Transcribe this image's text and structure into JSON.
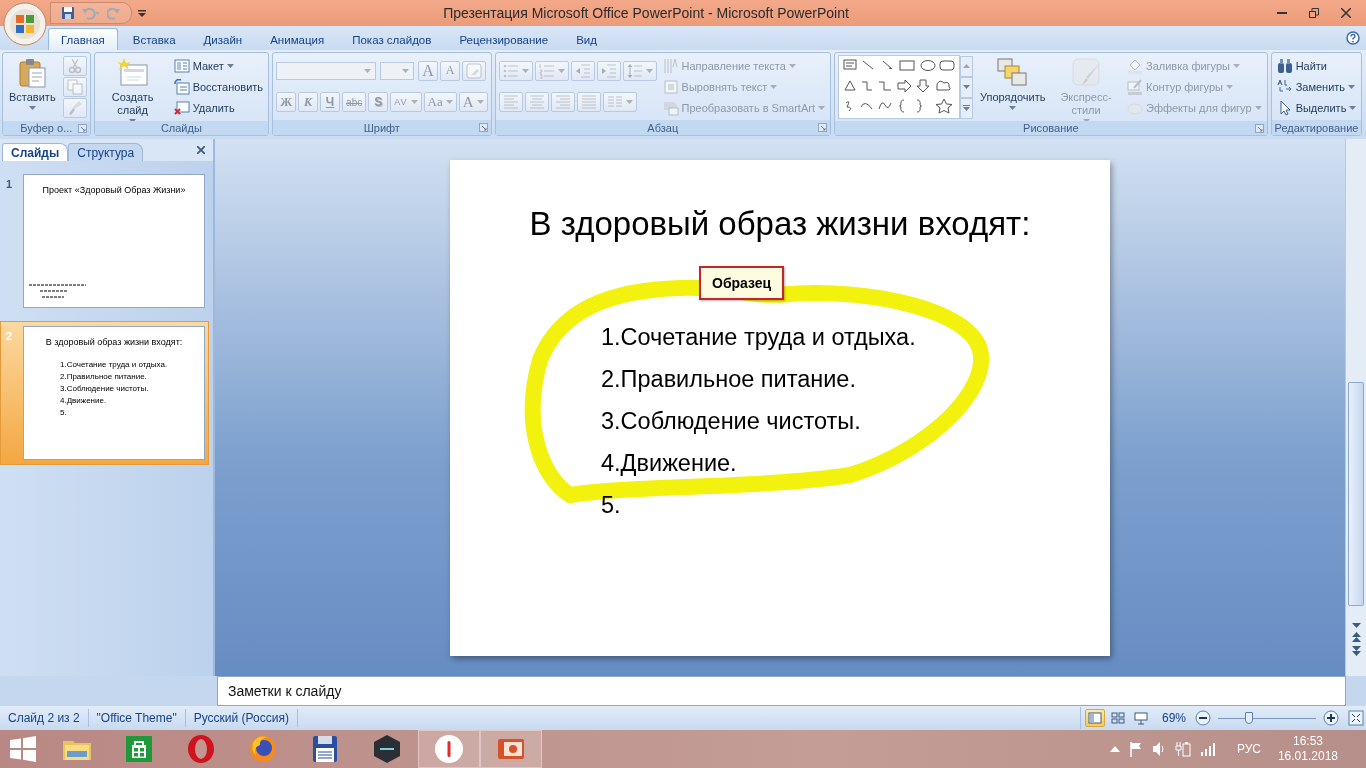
{
  "window": {
    "title": "Презентация Microsoft Office PowerPoint - Microsoft PowerPoint"
  },
  "ribbon": {
    "tabs": [
      {
        "label": "Главная",
        "selected": true
      },
      {
        "label": "Вставка",
        "selected": false
      },
      {
        "label": "Дизайн",
        "selected": false
      },
      {
        "label": "Анимация",
        "selected": false
      },
      {
        "label": "Показ слайдов",
        "selected": false
      },
      {
        "label": "Рецензирование",
        "selected": false
      },
      {
        "label": "Вид",
        "selected": false
      }
    ],
    "groups": [
      {
        "label": "Буфер о...",
        "launcher": true,
        "sections": [
          [
            [
              {
                "kind": "paste",
                "label": "Вставить",
                "dropdown": true,
                "disabled": false
              }
            ]
          ],
          [
            [
              {
                "kind": "cut",
                "disabled": true
              }
            ],
            [
              {
                "kind": "copy",
                "disabled": true
              }
            ],
            [
              {
                "kind": "painter",
                "disabled": true
              }
            ]
          ]
        ]
      },
      {
        "label": "Слайды",
        "launcher": false,
        "sections": [
          [
            [
              {
                "kind": "new-slide",
                "label": "Создать слайд",
                "dropdown": true,
                "disabled": false
              }
            ]
          ],
          [
            [
              {
                "kind": "layout",
                "label": "Макет",
                "dropdown": true,
                "disabled": false
              }
            ],
            [
              {
                "kind": "reset",
                "label": "Восстановить",
                "disabled": false
              }
            ],
            [
              {
                "kind": "delete",
                "label": "Удалить",
                "disabled": false
              }
            ]
          ]
        ]
      },
      {
        "label": "Шрифт",
        "launcher": true,
        "sections": [
          [
            [
              {
                "kind": "font-name",
                "disabled": true
              },
              {
                "kind": "font-size",
                "disabled": true
              },
              {
                "kind": "grow",
                "label": "A",
                "disabled": true
              },
              {
                "kind": "shrink",
                "label": "A",
                "disabled": true
              },
              {
                "kind": "clear",
                "disabled": true
              }
            ],
            [
              {
                "kind": "bold",
                "label": "Ж",
                "disabled": true
              },
              {
                "kind": "italic",
                "label": "К",
                "disabled": true
              },
              {
                "kind": "underline",
                "label": "Ч",
                "disabled": true
              },
              {
                "kind": "strike",
                "label": "abc",
                "disabled": true
              },
              {
                "kind": "shadow",
                "label": "S",
                "disabled": true
              },
              {
                "kind": "spacing",
                "label": "AV",
                "dropdown": true,
                "disabled": true
              },
              {
                "kind": "case",
                "label": "Aa",
                "dropdown": true,
                "disabled": true
              },
              {
                "kind": "color",
                "label": "A",
                "dropdown": true,
                "disabled": true
              }
            ]
          ]
        ]
      },
      {
        "label": "Абзац",
        "launcher": true,
        "sections": [
          [
            [
              {
                "kind": "bullets",
                "dropdown": true,
                "disabled": true
              },
              {
                "kind": "numbering",
                "dropdown": true,
                "disabled": true
              },
              {
                "kind": "outdent",
                "disabled": true
              },
              {
                "kind": "indent",
                "disabled": true
              },
              {
                "kind": "line-spacing",
                "dropdown": true,
                "disabled": true
              }
            ],
            [
              {
                "kind": "align-left",
                "disabled": true
              },
              {
                "kind": "align-center",
                "disabled": true
              },
              {
                "kind": "align-right",
                "disabled": true
              },
              {
                "kind": "justify",
                "disabled": true
              },
              {
                "kind": "columns",
                "dropdown": true,
                "disabled": true
              }
            ]
          ],
          [
            [
              {
                "kind": "text-direction",
                "label": "Направление текста",
                "dropdown": true,
                "disabled": true
              }
            ],
            [
              {
                "kind": "align-text",
                "label": "Выровнять текст",
                "dropdown": true,
                "disabled": true
              }
            ],
            [
              {
                "kind": "smartart",
                "label": "Преобразовать в SmartArt",
                "dropdown": true,
                "disabled": true
              }
            ]
          ]
        ]
      },
      {
        "label": "Рисование",
        "launcher": true,
        "sections": [
          [
            [
              {
                "kind": "shapes",
                "disabled": false
              }
            ]
          ],
          [
            [
              {
                "kind": "arrange",
                "label": "Упорядочить",
                "dropdown": true,
                "disabled": false
              }
            ]
          ],
          [
            [
              {
                "kind": "quick-styles",
                "label": "Экспресс-стили",
                "dropdown": true,
                "disabled": true
              }
            ]
          ],
          [
            [
              {
                "kind": "fill",
                "label": "Заливка фигуры",
                "dropdown": true,
                "disabled": true
              }
            ],
            [
              {
                "kind": "outline",
                "label": "Контур фигуры",
                "dropdown": true,
                "disabled": true
              }
            ],
            [
              {
                "kind": "effects",
                "label": "Эффекты для фигур",
                "dropdown": true,
                "disabled": true
              }
            ]
          ]
        ]
      },
      {
        "label": "Редактирование",
        "launcher": false,
        "sections": [
          [
            [
              {
                "kind": "find",
                "label": "Найти",
                "disabled": false
              }
            ],
            [
              {
                "kind": "replace",
                "label": "Заменить",
                "dropdown": true,
                "disabled": false
              }
            ],
            [
              {
                "kind": "select",
                "label": "Выделить",
                "dropdown": true,
                "disabled": false
              }
            ]
          ]
        ]
      }
    ]
  },
  "slides_panel": {
    "tabs": [
      {
        "label": "Слайды",
        "selected": true
      },
      {
        "label": "Структура",
        "selected": false
      }
    ],
    "thumbnails": [
      {
        "number": "1",
        "kind": "title",
        "selected": false,
        "title": "Проект «Здоровый Образ Жизни»"
      },
      {
        "number": "2",
        "kind": "list",
        "selected": true,
        "title": "В здоровый образ жизни входят:",
        "items": [
          "1.Сочетание труда и отдыха.",
          "2.Правильное питание.",
          "3.Соблюдение чистоты.",
          "4.Движение.",
          "5."
        ]
      }
    ]
  },
  "slide": {
    "title": "В здоровый образ жизни входят:",
    "items": [
      "1.Сочетание труда и отдыха.",
      "2.Правильное питание.",
      "3.Соблюдение чистоты.",
      "4.Движение.",
      "5."
    ],
    "tooltip": "Образец"
  },
  "notes": {
    "placeholder": "Заметки к слайду"
  },
  "status": {
    "items": [
      "Слайд 2 из 2",
      "\"Office Theme\"",
      "Русский (Россия)"
    ],
    "views": [
      {
        "kind": "normal",
        "selected": true
      },
      {
        "kind": "sorter",
        "selected": false
      },
      {
        "kind": "show",
        "selected": false
      }
    ],
    "zoom": {
      "reading": "69%",
      "level": 0.32
    }
  },
  "taskbar": {
    "apps": [
      {
        "kind": "start",
        "open": false
      },
      {
        "kind": "explorer",
        "open": false
      },
      {
        "kind": "store",
        "open": false
      },
      {
        "kind": "opera",
        "open": false
      },
      {
        "kind": "firefox",
        "open": false
      },
      {
        "kind": "floppy",
        "open": false
      },
      {
        "kind": "nox",
        "open": false
      },
      {
        "kind": "yandex",
        "open": true
      },
      {
        "kind": "powerpoint",
        "open": true
      }
    ],
    "language": "РУС",
    "time": "16:53",
    "date": "16.01.2018"
  }
}
